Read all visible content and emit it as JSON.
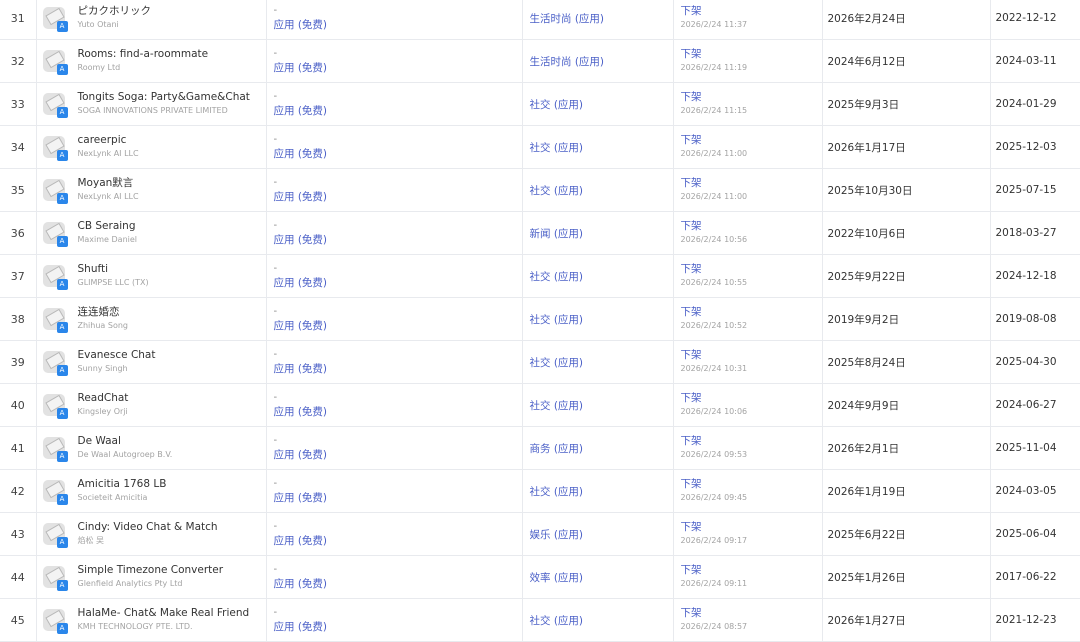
{
  "colors": {
    "link": "#4a5fc7",
    "muted": "#a3a3a3",
    "border": "#e8eaee",
    "badge": "#2a86ea"
  },
  "icons": {
    "app_placeholder": "placeholder-image-icon",
    "store_badge": "app-store-icon"
  },
  "store_badge_glyph": "A",
  "rows": [
    {
      "rank": "31",
      "name": "ピカクホリック",
      "developer": "Yuto Otani",
      "price_dash": "-",
      "price": "应用 (免费)",
      "category": "生活时尚 (应用)",
      "status": "下架",
      "time": "2026/2/24 11:37",
      "release": "2026年2月24日",
      "updated": "2022-12-12"
    },
    {
      "rank": "32",
      "name": "Rooms: find-a-roommate",
      "developer": "Roomy Ltd",
      "price_dash": "-",
      "price": "应用 (免费)",
      "category": "生活时尚 (应用)",
      "status": "下架",
      "time": "2026/2/24 11:19",
      "release": "2024年6月12日",
      "updated": "2024-03-11"
    },
    {
      "rank": "33",
      "name": "Tongits Soga: Party&Game&Chat",
      "developer": "SOGA INNOVATIONS PRIVATE LIMITED",
      "price_dash": "-",
      "price": "应用 (免费)",
      "category": "社交 (应用)",
      "status": "下架",
      "time": "2026/2/24 11:15",
      "release": "2025年9月3日",
      "updated": "2024-01-29"
    },
    {
      "rank": "34",
      "name": "careerpic",
      "developer": "NexLynk AI LLC",
      "price_dash": "-",
      "price": "应用 (免费)",
      "category": "社交 (应用)",
      "status": "下架",
      "time": "2026/2/24 11:00",
      "release": "2026年1月17日",
      "updated": "2025-12-03"
    },
    {
      "rank": "35",
      "name": "Moyan默言",
      "developer": "NexLynk AI LLC",
      "price_dash": "-",
      "price": "应用 (免费)",
      "category": "社交 (应用)",
      "status": "下架",
      "time": "2026/2/24 11:00",
      "release": "2025年10月30日",
      "updated": "2025-07-15"
    },
    {
      "rank": "36",
      "name": "CB Seraing",
      "developer": "Maxime Daniel",
      "price_dash": "-",
      "price": "应用 (免费)",
      "category": "新闻 (应用)",
      "status": "下架",
      "time": "2026/2/24 10:56",
      "release": "2022年10月6日",
      "updated": "2018-03-27"
    },
    {
      "rank": "37",
      "name": "Shufti",
      "developer": "GLIMPSE LLC (TX)",
      "price_dash": "-",
      "price": "应用 (免费)",
      "category": "社交 (应用)",
      "status": "下架",
      "time": "2026/2/24 10:55",
      "release": "2025年9月22日",
      "updated": "2024-12-18"
    },
    {
      "rank": "38",
      "name": "连连婚恋",
      "developer": "Zhihua Song",
      "price_dash": "-",
      "price": "应用 (免费)",
      "category": "社交 (应用)",
      "status": "下架",
      "time": "2026/2/24 10:52",
      "release": "2019年9月2日",
      "updated": "2019-08-08"
    },
    {
      "rank": "39",
      "name": "Evanesce Chat",
      "developer": "Sunny Singh",
      "price_dash": "-",
      "price": "应用 (免费)",
      "category": "社交 (应用)",
      "status": "下架",
      "time": "2026/2/24 10:31",
      "release": "2025年8月24日",
      "updated": "2025-04-30"
    },
    {
      "rank": "40",
      "name": "ReadChat",
      "developer": "Kingsley Orji",
      "price_dash": "-",
      "price": "应用 (免费)",
      "category": "社交 (应用)",
      "status": "下架",
      "time": "2026/2/24 10:06",
      "release": "2024年9月9日",
      "updated": "2024-06-27"
    },
    {
      "rank": "41",
      "name": "De Waal",
      "developer": "De Waal Autogroep B.V.",
      "price_dash": "-",
      "price": "应用 (免费)",
      "category": "商务 (应用)",
      "status": "下架",
      "time": "2026/2/24 09:53",
      "release": "2026年2月1日",
      "updated": "2025-11-04"
    },
    {
      "rank": "42",
      "name": "Amicitia 1768 LB",
      "developer": "Societeit Amicitia",
      "price_dash": "-",
      "price": "应用 (免费)",
      "category": "社交 (应用)",
      "status": "下架",
      "time": "2026/2/24 09:45",
      "release": "2026年1月19日",
      "updated": "2024-03-05"
    },
    {
      "rank": "43",
      "name": "Cindy: Video Chat & Match",
      "developer": "焰松 吴",
      "price_dash": "-",
      "price": "应用 (免费)",
      "category": "娱乐 (应用)",
      "status": "下架",
      "time": "2026/2/24 09:17",
      "release": "2025年6月22日",
      "updated": "2025-06-04"
    },
    {
      "rank": "44",
      "name": "Simple Timezone Converter",
      "developer": "Glenfield Analytics Pty Ltd",
      "price_dash": "-",
      "price": "应用 (免费)",
      "category": "效率 (应用)",
      "status": "下架",
      "time": "2026/2/24 09:11",
      "release": "2025年1月26日",
      "updated": "2017-06-22"
    },
    {
      "rank": "45",
      "name": "HalaMe- Chat& Make Real Friend",
      "developer": "KMH TECHNOLOGY PTE. LTD.",
      "price_dash": "-",
      "price": "应用 (免费)",
      "category": "社交 (应用)",
      "status": "下架",
      "time": "2026/2/24 08:57",
      "release": "2026年1月27日",
      "updated": "2021-12-23"
    }
  ]
}
